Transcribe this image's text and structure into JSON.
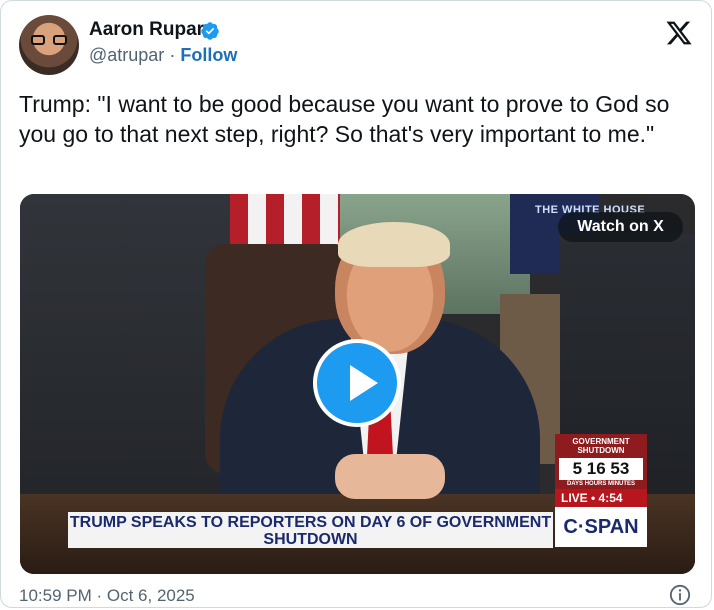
{
  "author": {
    "name": "Aaron Rupar",
    "handle": "@atrupar",
    "separator": "·",
    "follow_label": "Follow"
  },
  "tweet": {
    "text": "Trump: \"I want to be good because you want to prove to God so you go to that next step, right? So that's very important to me.\"",
    "timestamp": "10:59 PM · Oct 6, 2025"
  },
  "media": {
    "watch_label": "Watch on X",
    "channel_label": "THE WHITE HOUSE",
    "shutdown_title": "GOVERNMENT SHUTDOWN",
    "shutdown_count": "5 16 53",
    "shutdown_units": "DAYS HOURS MINUTES",
    "live_label": "LIVE • 4:54",
    "headline": "TRUMP SPEAKS TO REPORTERS ON DAY 6 OF GOVERNMENT SHUTDOWN",
    "network": "C·SPAN"
  },
  "icons": {
    "verified": "verified-badge-icon",
    "logo": "x-logo-icon",
    "info": "info-icon",
    "play": "play-icon"
  },
  "colors": {
    "follow": "#1d6fb8",
    "verified": "#1d9bf0",
    "play": "#1d9bf0",
    "secondary_text": "#536471"
  }
}
